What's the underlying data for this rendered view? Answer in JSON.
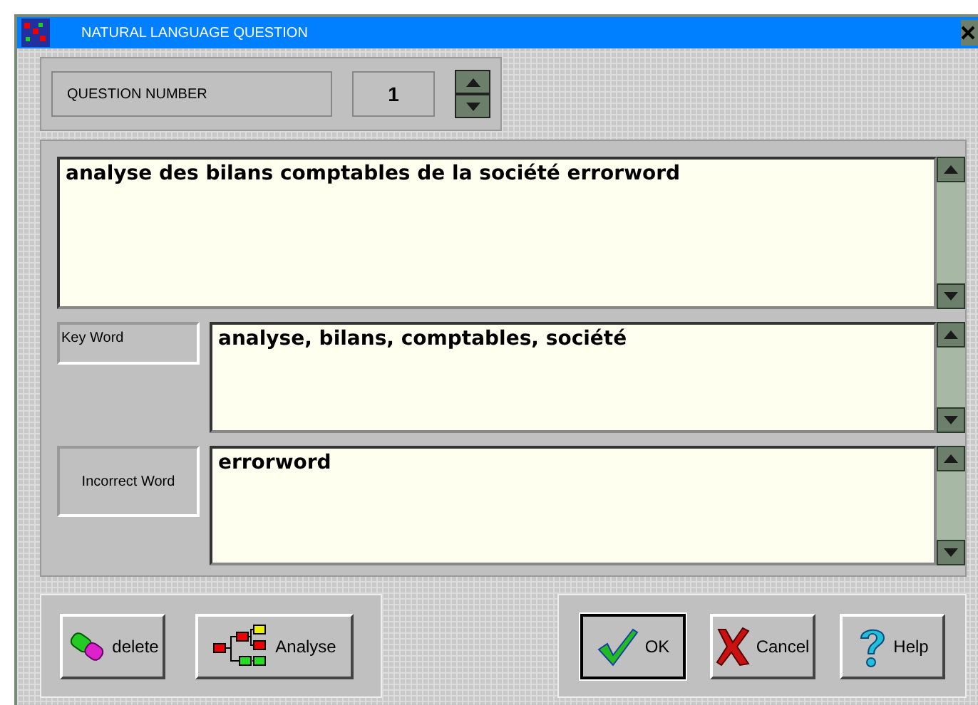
{
  "window": {
    "title": "NATURAL LANGUAGE QUESTION"
  },
  "question_number": {
    "label": "QUESTION NUMBER",
    "value": "1"
  },
  "question": {
    "value": "analyse des bilans comptables de la société errorword"
  },
  "fields": [
    {
      "label": "Key Word",
      "value": "analyse, bilans, comptables, société"
    },
    {
      "label": "Incorrect Word",
      "value": "errorword"
    }
  ],
  "left_buttons": [
    {
      "kind": "delete",
      "label": "delete"
    },
    {
      "kind": "analyse",
      "label": "Analyse"
    }
  ],
  "right_buttons": [
    {
      "kind": "ok",
      "label": "OK",
      "selected": true
    },
    {
      "kind": "cancel",
      "label": "Cancel",
      "selected": false
    },
    {
      "kind": "help",
      "label": "Help",
      "selected": false
    }
  ]
}
